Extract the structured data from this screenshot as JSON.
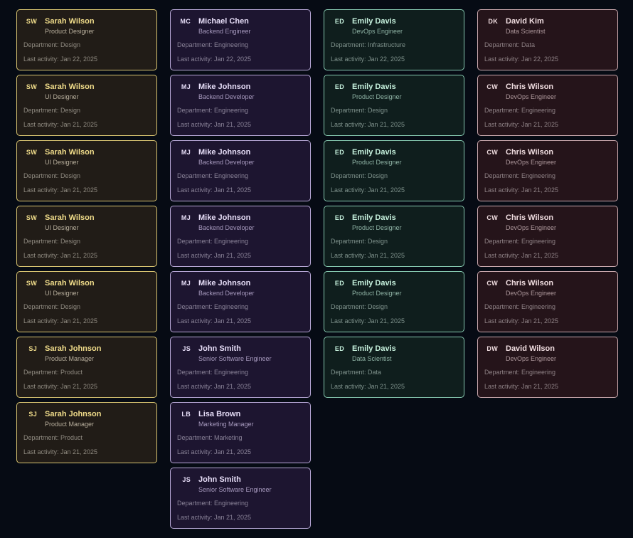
{
  "columns": [
    {
      "theme": "yellow",
      "cards": [
        {
          "initials": "SW",
          "name": "Sarah Wilson",
          "role": "Product Designer",
          "department": "Department: Design",
          "activity": "Last activity: Jan 22, 2025"
        },
        {
          "initials": "SW",
          "name": "Sarah Wilson",
          "role": "UI Designer",
          "department": "Department: Design",
          "activity": "Last activity: Jan 21, 2025"
        },
        {
          "initials": "SW",
          "name": "Sarah Wilson",
          "role": "UI Designer",
          "department": "Department: Design",
          "activity": "Last activity: Jan 21, 2025"
        },
        {
          "initials": "SW",
          "name": "Sarah Wilson",
          "role": "UI Designer",
          "department": "Department: Design",
          "activity": "Last activity: Jan 21, 2025"
        },
        {
          "initials": "SW",
          "name": "Sarah Wilson",
          "role": "UI Designer",
          "department": "Department: Design",
          "activity": "Last activity: Jan 21, 2025"
        },
        {
          "initials": "SJ",
          "name": "Sarah Johnson",
          "role": "Product Manager",
          "department": "Department: Product",
          "activity": "Last activity: Jan 21, 2025"
        },
        {
          "initials": "SJ",
          "name": "Sarah Johnson",
          "role": "Product Manager",
          "department": "Department: Product",
          "activity": "Last activity: Jan 21, 2025"
        }
      ]
    },
    {
      "theme": "purple",
      "cards": [
        {
          "initials": "MC",
          "name": "Michael Chen",
          "role": "Backend Engineer",
          "department": "Department: Engineering",
          "activity": "Last activity: Jan 22, 2025"
        },
        {
          "initials": "MJ",
          "name": "Mike Johnson",
          "role": "Backend Developer",
          "department": "Department: Engineering",
          "activity": "Last activity: Jan 21, 2025"
        },
        {
          "initials": "MJ",
          "name": "Mike Johnson",
          "role": "Backend Developer",
          "department": "Department: Engineering",
          "activity": "Last activity: Jan 21, 2025"
        },
        {
          "initials": "MJ",
          "name": "Mike Johnson",
          "role": "Backend Developer",
          "department": "Department: Engineering",
          "activity": "Last activity: Jan 21, 2025"
        },
        {
          "initials": "MJ",
          "name": "Mike Johnson",
          "role": "Backend Developer",
          "department": "Department: Engineering",
          "activity": "Last activity: Jan 21, 2025"
        },
        {
          "initials": "JS",
          "name": "John Smith",
          "role": "Senior Software Engineer",
          "department": "Department: Engineering",
          "activity": "Last activity: Jan 21, 2025"
        },
        {
          "initials": "LB",
          "name": "Lisa Brown",
          "role": "Marketing Manager",
          "department": "Department: Marketing",
          "activity": "Last activity: Jan 21, 2025"
        },
        {
          "initials": "JS",
          "name": "John Smith",
          "role": "Senior Software Engineer",
          "department": "Department: Engineering",
          "activity": "Last activity: Jan 21, 2025"
        }
      ]
    },
    {
      "theme": "green",
      "cards": [
        {
          "initials": "ED",
          "name": "Emily Davis",
          "role": "DevOps Engineer",
          "department": "Department: Infrastructure",
          "activity": "Last activity: Jan 22, 2025"
        },
        {
          "initials": "ED",
          "name": "Emily Davis",
          "role": "Product Designer",
          "department": "Department: Design",
          "activity": "Last activity: Jan 21, 2025"
        },
        {
          "initials": "ED",
          "name": "Emily Davis",
          "role": "Product Designer",
          "department": "Department: Design",
          "activity": "Last activity: Jan 21, 2025"
        },
        {
          "initials": "ED",
          "name": "Emily Davis",
          "role": "Product Designer",
          "department": "Department: Design",
          "activity": "Last activity: Jan 21, 2025"
        },
        {
          "initials": "ED",
          "name": "Emily Davis",
          "role": "Product Designer",
          "department": "Department: Design",
          "activity": "Last activity: Jan 21, 2025"
        },
        {
          "initials": "ED",
          "name": "Emily Davis",
          "role": "Data Scientist",
          "department": "Department: Data",
          "activity": "Last activity: Jan 21, 2025"
        }
      ]
    },
    {
      "theme": "red",
      "cards": [
        {
          "initials": "DK",
          "name": "David Kim",
          "role": "Data Scientist",
          "department": "Department: Data",
          "activity": "Last activity: Jan 22, 2025"
        },
        {
          "initials": "CW",
          "name": "Chris Wilson",
          "role": "DevOps Engineer",
          "department": "Department: Engineering",
          "activity": "Last activity: Jan 21, 2025"
        },
        {
          "initials": "CW",
          "name": "Chris Wilson",
          "role": "DevOps Engineer",
          "department": "Department: Engineering",
          "activity": "Last activity: Jan 21, 2025"
        },
        {
          "initials": "CW",
          "name": "Chris Wilson",
          "role": "DevOps Engineer",
          "department": "Department: Engineering",
          "activity": "Last activity: Jan 21, 2025"
        },
        {
          "initials": "CW",
          "name": "Chris Wilson",
          "role": "DevOps Engineer",
          "department": "Department: Engineering",
          "activity": "Last activity: Jan 21, 2025"
        },
        {
          "initials": "DW",
          "name": "David Wilson",
          "role": "DevOps Engineer",
          "department": "Department: Engineering",
          "activity": "Last activity: Jan 21, 2025"
        }
      ]
    }
  ]
}
